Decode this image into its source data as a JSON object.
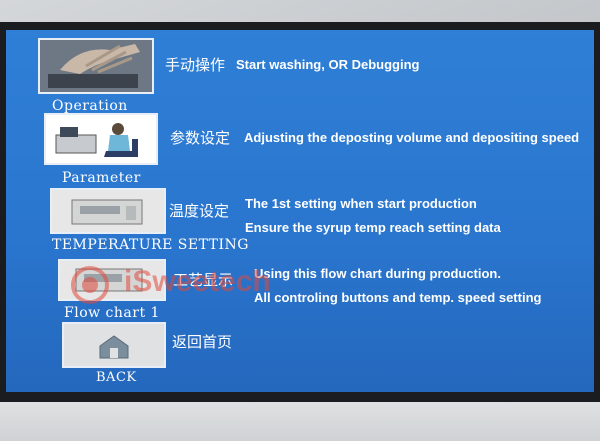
{
  "menu": [
    {
      "id": "operation",
      "label": "Operation",
      "cn_title": "手动操作",
      "desc": [
        "Start washing, OR  Debugging"
      ]
    },
    {
      "id": "parameter",
      "label": "Parameter",
      "cn_title": "参数设定",
      "desc": [
        "Adjusting the deposting volume and depositing speed"
      ]
    },
    {
      "id": "temperature",
      "label": "TEMPERATURE SETTING",
      "cn_title": "温度设定",
      "desc": [
        "The 1st setting when start production",
        "Ensure the syrup temp reach setting data"
      ]
    },
    {
      "id": "flowchart",
      "label": "Flow chart 1",
      "cn_title": "工艺显示",
      "desc": [
        "Using this flow chart during production.",
        "All controling buttons and temp. speed setting"
      ]
    },
    {
      "id": "back",
      "label": "BACK",
      "cn_title": "返回首页",
      "desc": []
    }
  ],
  "watermark": "iSweetech",
  "colors": {
    "screen": "#2a76cf",
    "text": "#ffffff",
    "watermark": "#e04a3c"
  }
}
